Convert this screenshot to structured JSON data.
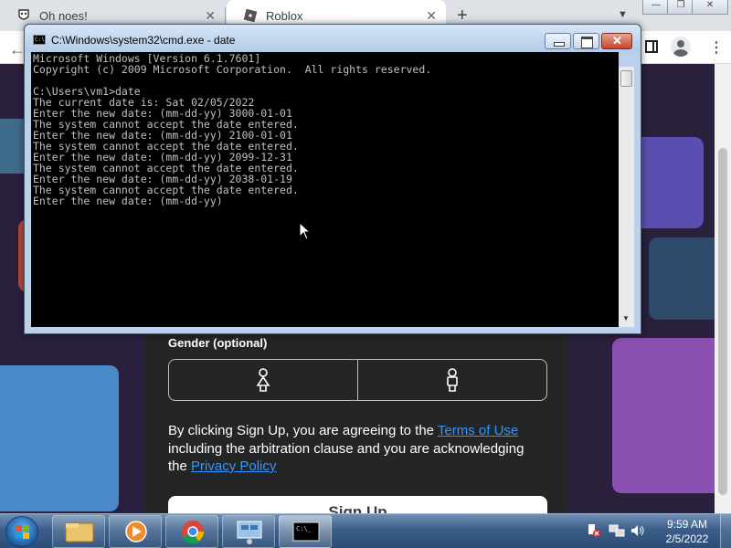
{
  "browser": {
    "tabs": [
      {
        "title": "Oh noes!"
      },
      {
        "title": "Roblox"
      }
    ]
  },
  "page": {
    "gender_label": "Gender (optional)",
    "terms": {
      "part1": "By clicking Sign Up, you are agreeing to the ",
      "terms_link": "Terms of Use",
      "part2": " including the arbitration clause and you are acknowledging the ",
      "privacy_link": "Privacy Policy"
    },
    "signup_label": "Sign Up"
  },
  "cmd": {
    "title": "C:\\Windows\\system32\\cmd.exe - date",
    "lines": [
      "Microsoft Windows [Version 6.1.7601]",
      "Copyright (c) 2009 Microsoft Corporation.  All rights reserved.",
      "",
      "C:\\Users\\vm1>date",
      "The current date is: Sat 02/05/2022",
      "Enter the new date: (mm-dd-yy) 3000-01-01",
      "The system cannot accept the date entered.",
      "Enter the new date: (mm-dd-yy) 2100-01-01",
      "The system cannot accept the date entered.",
      "Enter the new date: (mm-dd-yy) 2099-12-31",
      "The system cannot accept the date entered.",
      "Enter the new date: (mm-dd-yy) 2038-01-19",
      "The system cannot accept the date entered.",
      "Enter the new date: (mm-dd-yy)"
    ]
  },
  "taskbar": {
    "time": "9:59 AM",
    "date": "2/5/2022"
  },
  "icons": {
    "tab1": "favicon-icon",
    "tab2": "roblox-icon",
    "start": "windows-start-icon",
    "apps": [
      "explorer-icon",
      "media-player-icon",
      "chrome-icon",
      "network-icon",
      "cmd-icon"
    ],
    "tray": [
      "action-center-icon",
      "network-tray-icon",
      "volume-icon"
    ]
  },
  "colors": {
    "console_bg": "#000000",
    "console_text": "#c0c0c0",
    "roblox_card": "#232527",
    "link": "#3396ff"
  }
}
